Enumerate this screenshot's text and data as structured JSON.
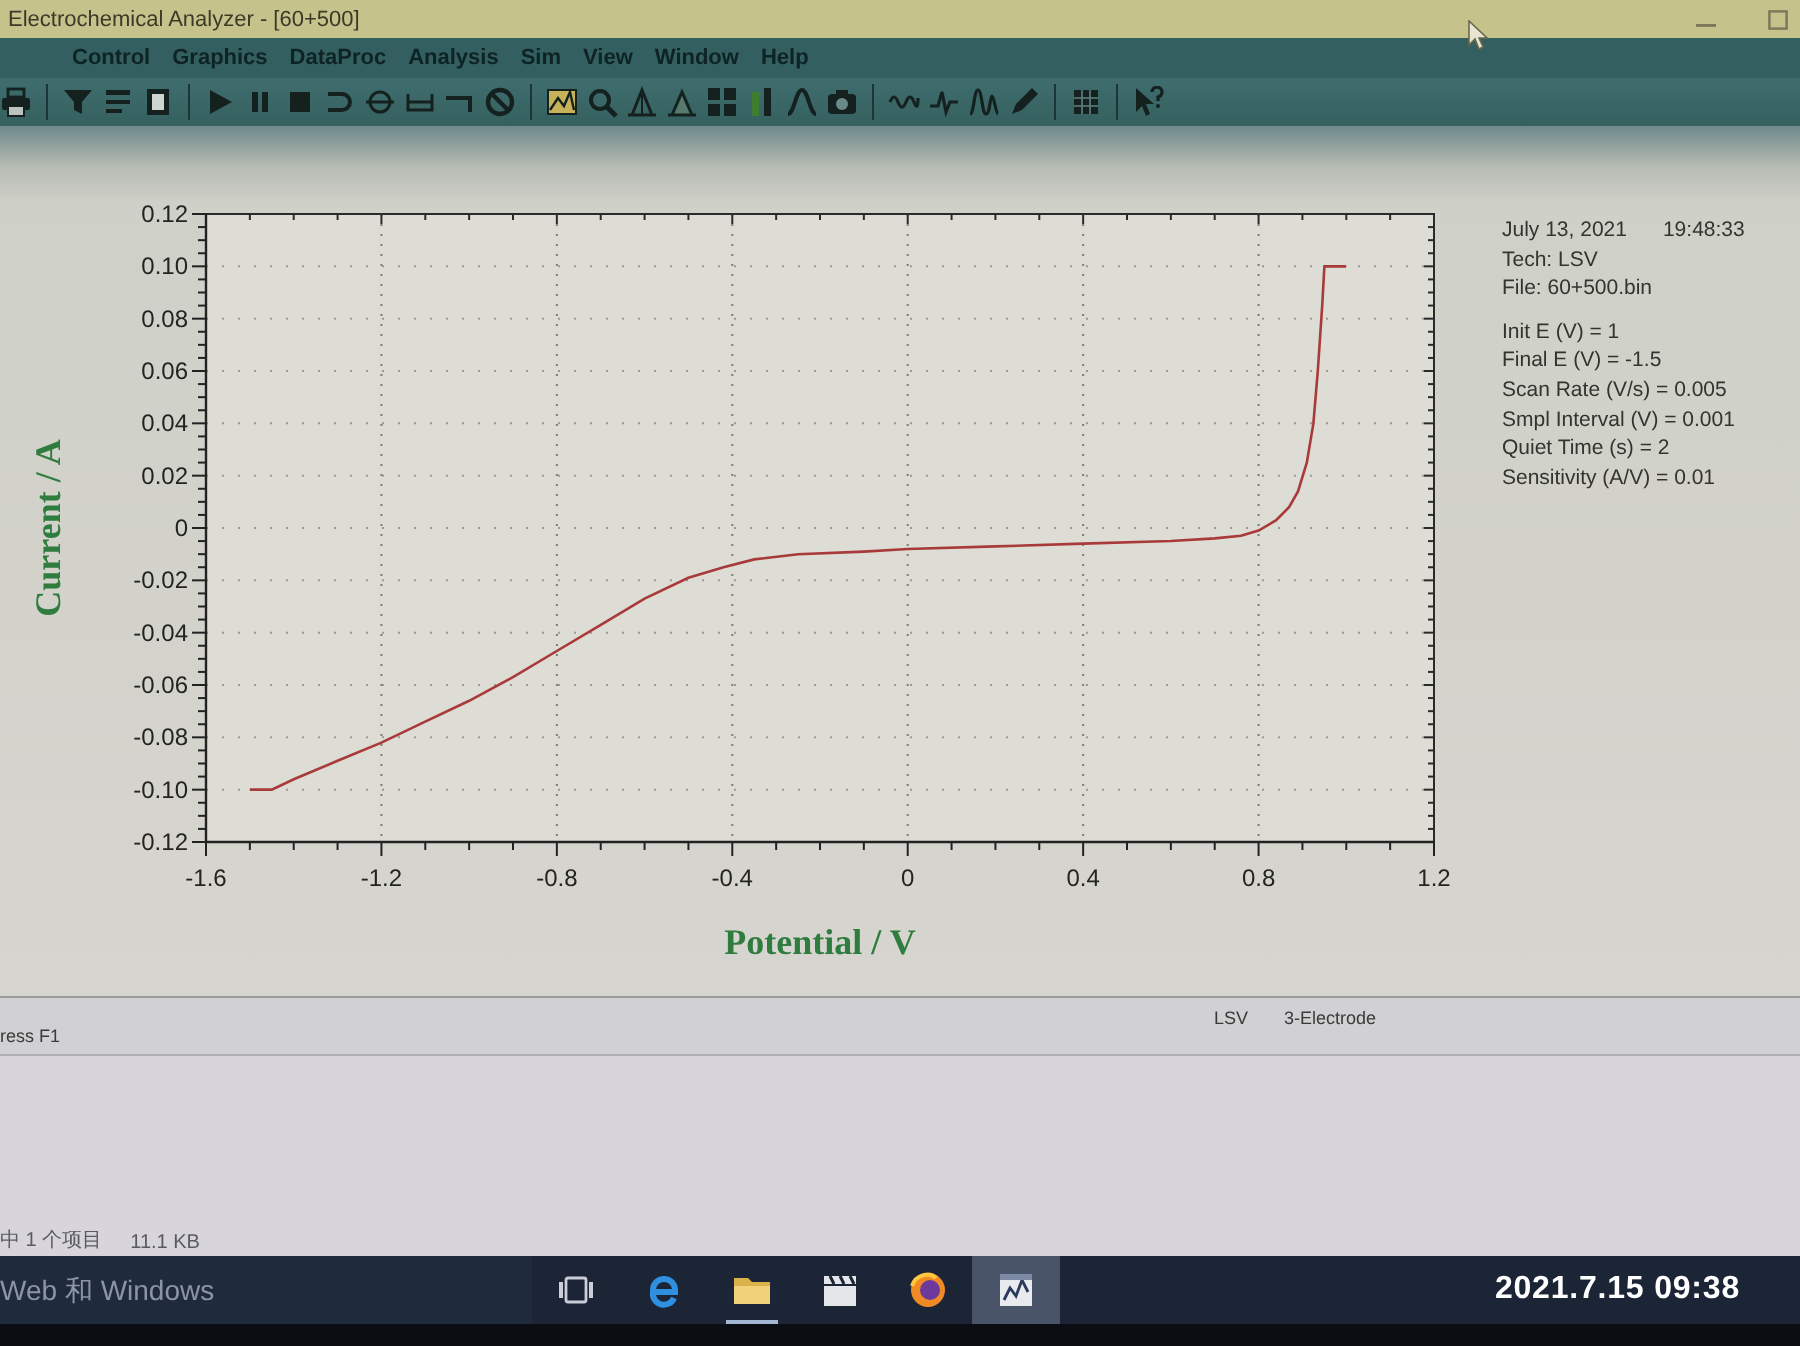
{
  "window": {
    "title": "Electrochemical Analyzer - [60+500]"
  },
  "menu": [
    "Control",
    "Graphics",
    "DataProc",
    "Analysis",
    "Sim",
    "View",
    "Window",
    "Help"
  ],
  "plot": {
    "chart_data": {
      "type": "line",
      "xlabel": "Potential / V",
      "ylabel": "Current / A",
      "x": [
        -1.5,
        -1.45,
        -1.4,
        -1.3,
        -1.2,
        -1.1,
        -1.0,
        -0.9,
        -0.8,
        -0.7,
        -0.6,
        -0.5,
        -0.42,
        -0.35,
        -0.25,
        -0.1,
        0,
        0.2,
        0.4,
        0.6,
        0.7,
        0.76,
        0.8,
        0.84,
        0.87,
        0.89,
        0.91,
        0.925,
        0.935,
        0.945,
        0.95,
        1.0
      ],
      "series": [
        {
          "color": "#a83a3a",
          "values": [
            -0.1,
            -0.1,
            -0.096,
            -0.089,
            -0.082,
            -0.074,
            -0.066,
            -0.057,
            -0.047,
            -0.037,
            -0.027,
            -0.019,
            -0.015,
            -0.012,
            -0.01,
            -0.009,
            -0.008,
            -0.007,
            -0.006,
            -0.005,
            -0.004,
            -0.003,
            -0.001,
            0.003,
            0.008,
            0.014,
            0.025,
            0.04,
            0.06,
            0.085,
            0.1,
            0.1
          ]
        }
      ],
      "xlim": [
        -1.6,
        1.2
      ],
      "ylim": [
        -0.12,
        0.12
      ],
      "xticks": [
        -1.6,
        -1.2,
        -0.8,
        -0.4,
        0,
        0.4,
        0.8,
        1.2
      ],
      "yticks": [
        0.12,
        {
          "value": 0.1,
          "label": "0.10"
        },
        0.08,
        0.06,
        0.04,
        0.02,
        0,
        -0.02,
        -0.04,
        -0.06,
        -0.08,
        {
          "value": -0.1,
          "label": "-0.10"
        },
        -0.12
      ],
      "grid": true
    },
    "run_info": {
      "date": "July 13, 2021",
      "time": "19:48:33",
      "header_lines": [
        "Tech: LSV",
        "File: 60+500.bin"
      ],
      "parameters": [
        "Init E (V) = 1",
        "Final E (V) = -1.5",
        "Scan Rate (V/s) = 0.005",
        "Smpl Interval (V) = 0.001",
        "Quiet Time (s) = 2",
        "Sensitivity (A/V) = 0.01"
      ]
    }
  },
  "status_bar": {
    "hint": "ress F1",
    "technique": "LSV",
    "electrode_mode": "3-Electrode"
  },
  "explorer_status": {
    "selection": "中 1 个项目",
    "size": "11.1 KB"
  },
  "taskbar": {
    "search": {
      "placeholder": "Web 和 Windows"
    },
    "apps": [
      {
        "kind": "task_view",
        "running": false,
        "selected": false
      },
      {
        "kind": "browser",
        "running": false,
        "selected": false
      },
      {
        "kind": "folder",
        "running": true,
        "selected": false
      },
      {
        "kind": "film",
        "running": false,
        "selected": false
      },
      {
        "kind": "globe",
        "running": false,
        "selected": false
      },
      {
        "kind": "analyzer",
        "running": false,
        "selected": true
      }
    ]
  },
  "photo_timestamp": "2021.7.15 09:38"
}
